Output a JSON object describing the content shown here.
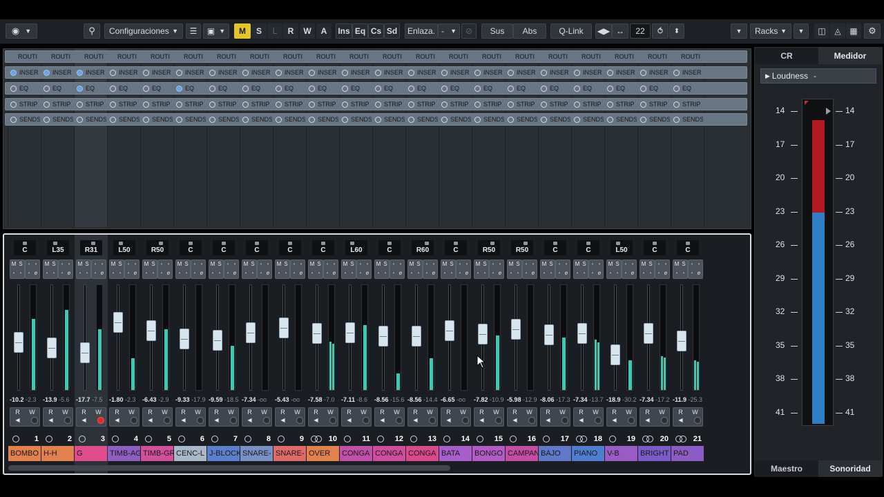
{
  "toolbar": {
    "configs_label": "Configuraciones",
    "btn_m": "M",
    "btn_s": "S",
    "btn_l": "L",
    "btn_r": "R",
    "btn_w": "W",
    "btn_a": "A",
    "btn_ins": "Ins",
    "btn_eq": "Eq",
    "btn_cs": "Cs",
    "btn_sd": "Sd",
    "link_label": "Enlaza.",
    "link_value": "-",
    "sus_label": "Sus",
    "abs_label": "Abs",
    "qlink_label": "Q-Link",
    "channel_count": "22",
    "racks_label": "Racks"
  },
  "rack": {
    "rows": [
      "ROUTI",
      "INSER",
      "EQ",
      "STRIP",
      "SENDS"
    ]
  },
  "right_panel": {
    "tab_cr": "CR",
    "tab_meter": "Medidor",
    "loudness_label": "Loudness",
    "loudness_value": "-",
    "scale": [
      "14",
      "17",
      "20",
      "23",
      "26",
      "29",
      "32",
      "35",
      "38",
      "41"
    ],
    "scale_right": [
      "14",
      "17",
      "20",
      "23",
      "26",
      "29",
      "32",
      "35",
      "38",
      "41"
    ],
    "bottom_left": "Maestro",
    "bottom_right": "Sonoridad"
  },
  "mixer": {
    "m_label": "M",
    "s_label": "S",
    "r_label": "R",
    "w_label": "W",
    "channels": [
      {
        "num": "1",
        "name": "BOMBO",
        "pan": "C",
        "vol": "-10.2",
        "peak": "-2.3",
        "color": "#e0814e",
        "fader": 0.44,
        "meter": 0.68,
        "blue_insert": true,
        "blue_eq": false,
        "stereo": false
      },
      {
        "num": "2",
        "name": "H-H",
        "pan": "L35",
        "vol": "-13.9",
        "peak": "-5.6",
        "color": "#e0814e",
        "fader": 0.38,
        "meter": 0.76,
        "blue_insert": true,
        "blue_eq": false,
        "stereo": false
      },
      {
        "num": "3",
        "name": "G",
        "pan": "R31",
        "vol": "-17.7",
        "peak": "-7.5",
        "color": "#e04d8c",
        "fader": 0.32,
        "meter": 0.58,
        "blue_insert": true,
        "blue_eq": true,
        "stereo": false,
        "selected": true,
        "rec_on": true
      },
      {
        "num": "4",
        "name": "TIMB-AG",
        "pan": "L50",
        "vol": "-1.80",
        "peak": "-2.3",
        "color": "#8e5fc0",
        "fader": 0.68,
        "meter": 0.3,
        "blue_insert": false,
        "blue_eq": false,
        "stereo": false
      },
      {
        "num": "5",
        "name": "TIMB-GR",
        "pan": "R50",
        "vol": "-6.43",
        "peak": "-2.9",
        "color": "#d0509a",
        "fader": 0.58,
        "meter": 0.58,
        "blue_insert": false,
        "blue_eq": false,
        "stereo": false
      },
      {
        "num": "6",
        "name": "CENC-L",
        "pan": "C",
        "vol": "-9.33",
        "peak": "-17.9",
        "color": "#a9b7c6",
        "fader": 0.48,
        "meter": 0.0,
        "blue_insert": false,
        "blue_eq": true,
        "stereo": false
      },
      {
        "num": "7",
        "name": "J-BLOCK",
        "pan": "C",
        "vol": "-9.59",
        "peak": "-18.5",
        "color": "#5a7fcc",
        "fader": 0.47,
        "meter": 0.42,
        "blue_insert": false,
        "blue_eq": false,
        "stereo": false
      },
      {
        "num": "8",
        "name": "SNARE-",
        "pan": "C",
        "vol": "-7.34",
        "peak": "-oo",
        "color": "#7a90c4",
        "fader": 0.56,
        "meter": 0.0,
        "blue_insert": false,
        "blue_eq": false,
        "stereo": false
      },
      {
        "num": "9",
        "name": "SNARE-",
        "pan": "C",
        "vol": "-5.43",
        "peak": "-oo",
        "color": "#e06a6a",
        "fader": 0.61,
        "meter": 0.0,
        "blue_insert": false,
        "blue_eq": false,
        "stereo": false
      },
      {
        "num": "10",
        "name": "OVER",
        "pan": "C",
        "vol": "-7.58",
        "peak": "-7.0",
        "color": "#e0814e",
        "fader": 0.55,
        "meter": 0.46,
        "blue_insert": false,
        "blue_eq": false,
        "stereo": true
      },
      {
        "num": "11",
        "name": "CONGA",
        "pan": "L60",
        "vol": "-7.11",
        "peak": "-8.6",
        "color": "#c050a8",
        "fader": 0.56,
        "meter": 0.62,
        "blue_insert": false,
        "blue_eq": false,
        "stereo": false
      },
      {
        "num": "12",
        "name": "CONGA",
        "pan": "C",
        "vol": "-8.56",
        "peak": "-15.6",
        "color": "#d04c9c",
        "fader": 0.52,
        "meter": 0.16,
        "blue_insert": false,
        "blue_eq": false,
        "stereo": false
      },
      {
        "num": "13",
        "name": "CONGA",
        "pan": "R60",
        "vol": "-8.56",
        "peak": "-14.4",
        "color": "#d84a8a",
        "fader": 0.52,
        "meter": 0.3,
        "blue_insert": false,
        "blue_eq": false,
        "stereo": false
      },
      {
        "num": "14",
        "name": "BATA",
        "pan": "C",
        "vol": "-6.65",
        "peak": "-oo",
        "color": "#a65fc8",
        "fader": 0.58,
        "meter": 0.0,
        "blue_insert": false,
        "blue_eq": false,
        "stereo": false
      },
      {
        "num": "15",
        "name": "BONGO",
        "pan": "R50",
        "vol": "-7.82",
        "peak": "-10.9",
        "color": "#b05cc4",
        "fader": 0.54,
        "meter": 0.52,
        "blue_insert": false,
        "blue_eq": false,
        "stereo": false
      },
      {
        "num": "16",
        "name": "CAMPANA",
        "pan": "R50",
        "vol": "-5.98",
        "peak": "-12.9",
        "color": "#c44ea4",
        "fader": 0.6,
        "meter": 0.0,
        "blue_insert": false,
        "blue_eq": false,
        "stereo": false
      },
      {
        "num": "17",
        "name": "BAJO",
        "pan": "C",
        "vol": "-8.06",
        "peak": "-17.3",
        "color": "#5f78c8",
        "fader": 0.53,
        "meter": 0.5,
        "blue_insert": false,
        "blue_eq": false,
        "stereo": false
      },
      {
        "num": "18",
        "name": "PIANO",
        "pan": "C",
        "vol": "-7.34",
        "peak": "-13.7",
        "color": "#4f7ed0",
        "fader": 0.55,
        "meter": 0.48,
        "blue_insert": false,
        "blue_eq": false,
        "stereo": true
      },
      {
        "num": "19",
        "name": "V-B",
        "pan": "L50",
        "vol": "-18.9",
        "peak": "-30.2",
        "color": "#9a5cc4",
        "fader": 0.3,
        "meter": 0.28,
        "blue_insert": false,
        "blue_eq": false,
        "stereo": false
      },
      {
        "num": "20",
        "name": "BRIGHT",
        "pan": "C",
        "vol": "-7.34",
        "peak": "-17.2",
        "color": "#7a5cc8",
        "fader": 0.55,
        "meter": 0.32,
        "blue_insert": false,
        "blue_eq": false,
        "stereo": true
      },
      {
        "num": "21",
        "name": "PAD",
        "pan": "C",
        "vol": "-11.9",
        "peak": "-25.3",
        "color": "#8a5cc4",
        "fader": 0.46,
        "meter": 0.28,
        "blue_insert": false,
        "blue_eq": false,
        "stereo": true
      }
    ]
  }
}
